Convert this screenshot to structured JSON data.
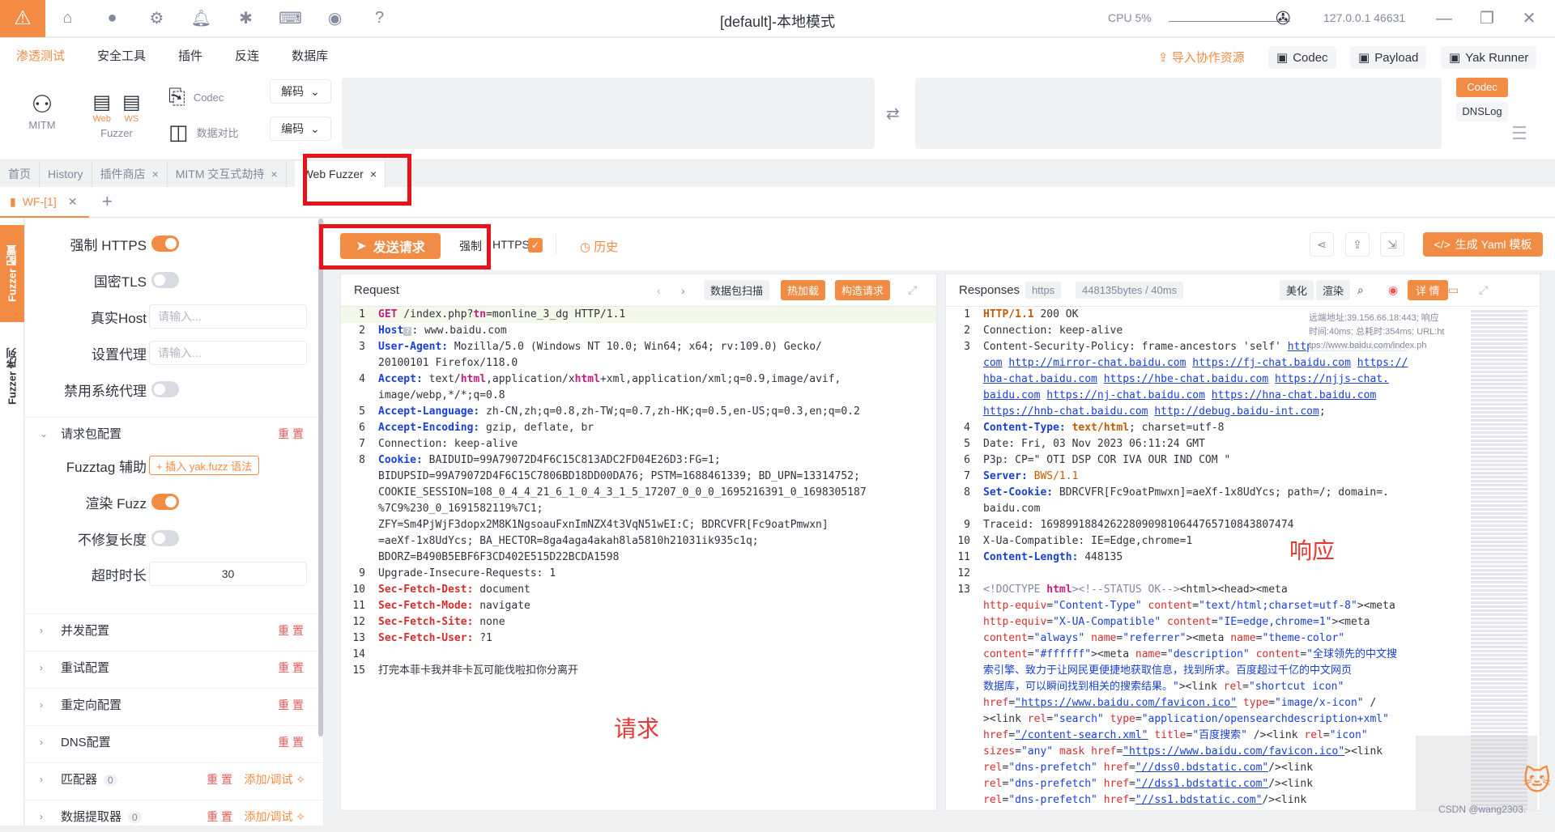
{
  "title_bar": {
    "title": "[default]-本地模式",
    "cpu": "CPU 5%",
    "host": "127.0.0.1 46631"
  },
  "menu": {
    "items": [
      "渗透测试",
      "安全工具",
      "插件",
      "反连",
      "数据库"
    ],
    "import_resource": "导入协作资源",
    "codec": "Codec",
    "payload": "Payload",
    "yak_runner": "Yak Runner"
  },
  "toolbar": {
    "mitm": "MITM",
    "fuzzer": "Fuzzer",
    "web_label": "Web",
    "ws_label": "WS",
    "codec": "Codec",
    "compare": "数据对比",
    "decode": "解码",
    "encode": "编码",
    "right_codec": "Codec",
    "right_dnslog": "DNSLog"
  },
  "page_tabs": [
    "首页",
    "History",
    "插件商店",
    "MITM 交互式劫持",
    "Web Fuzzer"
  ],
  "sub_tab": "WF-[1]",
  "rail": {
    "config": "Fuzzer 配置",
    "sequence": "Fuzzer 序列"
  },
  "config": {
    "force_https": "强制 HTTPS",
    "gm_tls": "国密TLS",
    "real_host": "真实Host",
    "real_host_placeholder": "请输入...",
    "proxy": "设置代理",
    "proxy_placeholder": "请输入...",
    "disable_proxy": "禁用系统代理",
    "req_pkg": "请求包配置",
    "reset": "重 置",
    "fuzztag": "Fuzztag 辅助",
    "insert_fuzz": "+ 插入 yak.fuzz 语法",
    "render_fuzz": "渲染 Fuzz",
    "no_fix_len": "不修复长度",
    "timeout": "超时时长",
    "timeout_value": "30",
    "sections": [
      {
        "title": "并发配置"
      },
      {
        "title": "重试配置"
      },
      {
        "title": "重定向配置"
      },
      {
        "title": "DNS配置"
      },
      {
        "title": "匹配器",
        "count": "0",
        "add": "添加/调试"
      },
      {
        "title": "数据提取器",
        "count": "0",
        "add": "添加/调试"
      }
    ]
  },
  "send_row": {
    "send": "发送请求",
    "force": "强制",
    "https": "HTTPS",
    "history": "历史",
    "yaml": "生成 Yaml 模板"
  },
  "request": {
    "title": "Request",
    "scan": "数据包扫描",
    "hotload": "热加载",
    "construct": "构造请求",
    "annotation": "请求"
  },
  "response": {
    "title": "Responses",
    "proto": "https",
    "size": "448135bytes / 40ms",
    "beautify": "美化",
    "render": "渲染",
    "detail": "详 情",
    "annotation": "响应",
    "info1": "远端地址:39.156.66.18:443; 响应",
    "info2": "时间:40ms; 总耗时:354ms; URL:ht",
    "info3": "tps://www.baidu.com/index.ph"
  },
  "watermark": "CSDN @wang2303."
}
